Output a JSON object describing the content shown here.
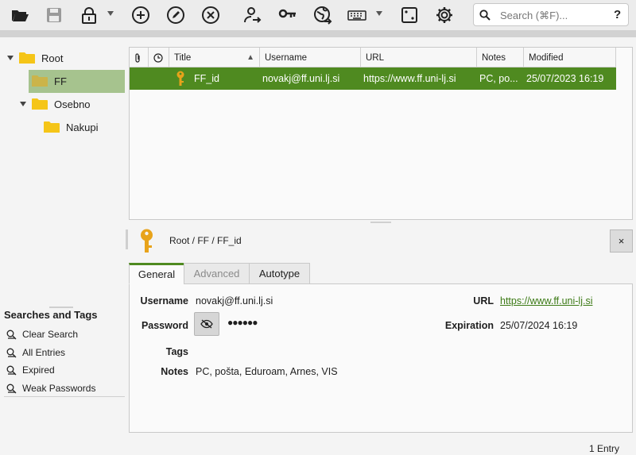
{
  "toolbar": {
    "buttons": [
      {
        "name": "open-database-button",
        "icon": "folder-open-icon"
      },
      {
        "name": "save-database-button",
        "icon": "save-icon"
      },
      {
        "name": "lock-database-button",
        "icon": "lock-icon"
      },
      {
        "name": "add-entry-button",
        "icon": "plus-circle-icon"
      },
      {
        "name": "edit-entry-button",
        "icon": "pencil-circle-icon"
      },
      {
        "name": "delete-entry-button",
        "icon": "x-circle-icon"
      },
      {
        "name": "copy-username-button",
        "icon": "user-arrow-icon"
      },
      {
        "name": "copy-password-button",
        "icon": "key-icon"
      },
      {
        "name": "open-url-button",
        "icon": "globe-arrow-icon"
      },
      {
        "name": "autotype-button",
        "icon": "keyboard-icon"
      },
      {
        "name": "password-generator-button",
        "icon": "dice-icon"
      },
      {
        "name": "settings-button",
        "icon": "gear-icon"
      }
    ],
    "search": {
      "placeholder": "Search (⌘F)...",
      "help": "?"
    }
  },
  "groups": [
    {
      "label": "Root",
      "expanded": true
    },
    {
      "label": "FF",
      "selected": true
    },
    {
      "label": "Osebno",
      "expanded": true
    },
    {
      "label": "Nakupi"
    }
  ],
  "searches": {
    "title": "Searches and Tags",
    "items": [
      "Clear Search",
      "All Entries",
      "Expired",
      "Weak Passwords"
    ]
  },
  "table": {
    "columns": [
      "Title",
      "Username",
      "URL",
      "Notes",
      "Modified"
    ],
    "sort_indicator": "▲",
    "rows": [
      {
        "title": "FF_id",
        "username": "novakj@ff.uni.lj.si",
        "url": "https://www.ff.uni-lj.si",
        "notes": "PC, po...",
        "modified": "25/07/2023 16:19"
      }
    ]
  },
  "preview": {
    "path": "Root / FF / FF_id",
    "close": "×",
    "tabs": [
      "General",
      "Advanced",
      "Autotype"
    ],
    "labels": {
      "username": "Username",
      "password": "Password",
      "tags": "Tags",
      "notes": "Notes",
      "url": "URL",
      "expiration": "Expiration"
    },
    "values": {
      "username": "novakj@ff.uni.lj.si",
      "password": "●●●●●●",
      "tags": "",
      "notes": "PC, pošta, Eduroam, Arnes, VIS",
      "url": "https://www.ff.uni-lj.si",
      "expiration": "25/07/2024 16:19"
    }
  },
  "status": "1 Entry",
  "colors": {
    "accent": "#4f8a20",
    "selection": "#a6c38e",
    "folder": "#f5c518",
    "key": "#e8a31a"
  }
}
